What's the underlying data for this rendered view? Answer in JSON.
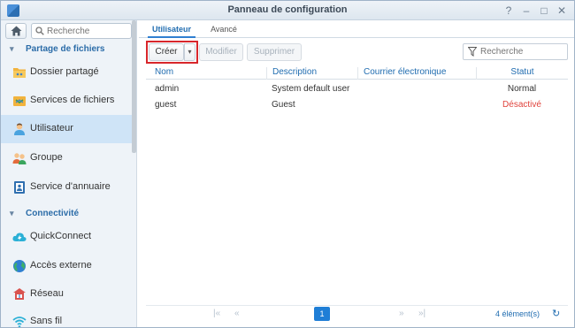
{
  "window": {
    "title": "Panneau de configuration",
    "controls": {
      "help": "?",
      "minimize": "–",
      "maximize": "□",
      "close": "✕"
    }
  },
  "sidebar": {
    "search_placeholder": "Recherche",
    "sections": [
      {
        "label": "Partage de fichiers",
        "expanded": true
      },
      {
        "label": "Connectivité",
        "expanded": true
      }
    ],
    "items": [
      {
        "label": "Dossier partagé",
        "icon": "shared-folder-icon"
      },
      {
        "label": "Services de fichiers",
        "icon": "file-services-icon"
      },
      {
        "label": "Utilisateur",
        "icon": "user-icon",
        "active": true
      },
      {
        "label": "Groupe",
        "icon": "group-icon"
      },
      {
        "label": "Service d'annuaire",
        "icon": "directory-icon"
      },
      {
        "label": "QuickConnect",
        "icon": "quickconnect-icon"
      },
      {
        "label": "Accès externe",
        "icon": "globe-icon"
      },
      {
        "label": "Réseau",
        "icon": "network-icon"
      },
      {
        "label": "Sans fil",
        "icon": "wifi-icon"
      }
    ]
  },
  "tabs": [
    {
      "label": "Utilisateur",
      "active": true
    },
    {
      "label": "Avancé",
      "active": false
    }
  ],
  "toolbar": {
    "create_label": "Créer",
    "modify_label": "Modifier",
    "delete_label": "Supprimer",
    "search_placeholder": "Recherche"
  },
  "table": {
    "columns": [
      "Nom",
      "Description",
      "Courrier électronique",
      "Statut"
    ],
    "rows": [
      {
        "name": "admin",
        "description": "System default user",
        "email": "",
        "status": "Normal",
        "status_color": "#333333"
      },
      {
        "name": "guest",
        "description": "Guest",
        "email": "",
        "status": "Désactivé",
        "status_color": "#e0433c"
      }
    ]
  },
  "pager": {
    "first": "|«",
    "prev": "«",
    "next": "»",
    "last": "»|",
    "page": "1",
    "count": "4 élément(s)",
    "refresh": "↻"
  },
  "colors": {
    "accent": "#1f7ed6",
    "highlight_border": "#d8262b",
    "disabled_status": "#e0433c"
  }
}
